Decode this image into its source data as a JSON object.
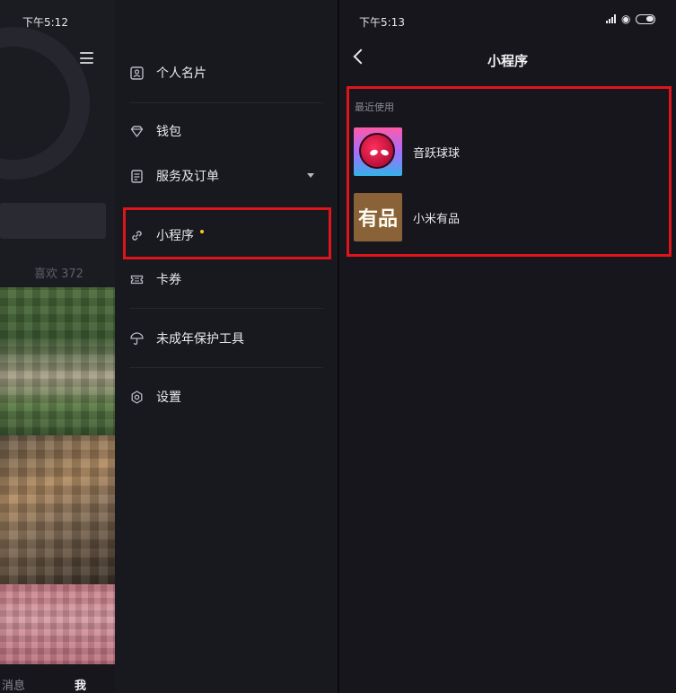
{
  "colors": {
    "highlight": "#e0151b",
    "dot": "#f6c92a",
    "background": "#16161c",
    "text": "#e8e8ec",
    "muted": "#8a8a94"
  },
  "left": {
    "status_time": "下午5:12",
    "background": {
      "likes": "喜欢 372",
      "tab_messages": "消息",
      "tab_me": "我"
    },
    "menu": [
      {
        "label": "个人名片",
        "icon": "id-card-icon"
      },
      {
        "label": "钱包",
        "icon": "diamond-icon"
      },
      {
        "label": "服务及订单",
        "icon": "document-icon"
      },
      {
        "label": "小程序",
        "icon": "link-icon"
      },
      {
        "label": "卡券",
        "icon": "ticket-icon"
      },
      {
        "label": "未成年保护工具",
        "icon": "umbrella-icon"
      },
      {
        "label": "设置",
        "icon": "gear-icon"
      }
    ]
  },
  "right": {
    "status_time": "下午5:13",
    "title": "小程序",
    "section_label": "最近使用",
    "apps": [
      {
        "name": "音跃球球",
        "icon": "game-ball-icon"
      },
      {
        "name": "小米有品",
        "icon": "youpin-logo-icon",
        "logo_text": "有品"
      }
    ]
  }
}
